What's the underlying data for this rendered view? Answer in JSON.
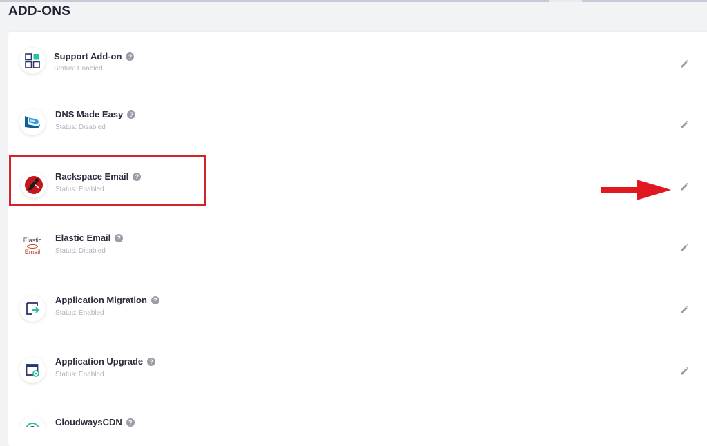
{
  "page": {
    "title": "ADD-ONS"
  },
  "addons": [
    {
      "name": "Support Add-on",
      "status": "Status: Enabled",
      "icon": "grid-icon"
    },
    {
      "name": "DNS Made Easy",
      "status": "Status: Disabled",
      "icon": "dns-made-easy-logo"
    },
    {
      "name": "Rackspace Email",
      "status": "Status: Enabled",
      "icon": "rackspace-logo"
    },
    {
      "name": "Elastic Email",
      "status": "Status: Disabled",
      "icon": "elastic-email-logo",
      "logo_text_top": "Elastic",
      "logo_text_bottom": "Email"
    },
    {
      "name": "Application Migration",
      "status": "Status: Enabled",
      "icon": "migration-icon"
    },
    {
      "name": "Application Upgrade",
      "status": "Status: Enabled",
      "icon": "upgrade-icon"
    },
    {
      "name": "CloudwaysCDN",
      "status": "",
      "icon": "cdn-icon"
    }
  ],
  "help_glyph": "?",
  "colors": {
    "accent_teal": "#2bbfa8",
    "highlight_red": "#d2232a",
    "navy": "#2a3466"
  }
}
